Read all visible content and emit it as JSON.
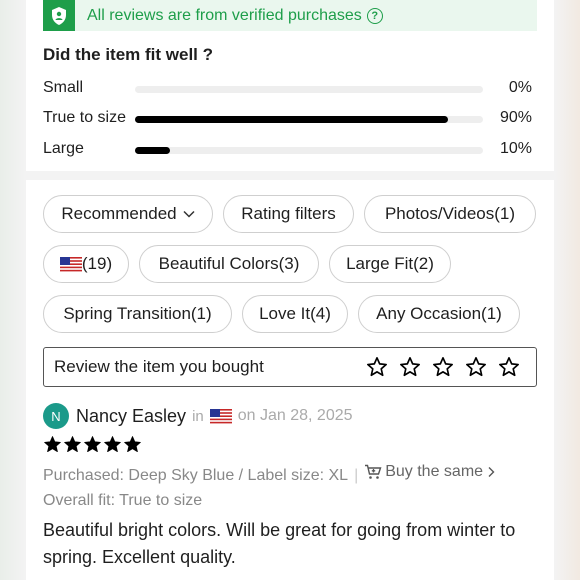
{
  "verified_banner": {
    "text": "All reviews are from verified purchases",
    "help_symbol": "?",
    "icon": "shield-check-icon",
    "color": "#1e9e4a"
  },
  "fit": {
    "title": "Did the item fit well ?",
    "rows": [
      {
        "label": "Small",
        "percent_text": "0%",
        "value": 0
      },
      {
        "label": "True to size",
        "percent_text": "90%",
        "value": 0.9
      },
      {
        "label": "Large",
        "percent_text": "10%",
        "value": 0.1
      }
    ]
  },
  "filters": {
    "recommended": "Recommended",
    "rating_filters": "Rating filters",
    "photos_videos": "Photos/Videos(1)",
    "us_count": "(19)",
    "beautiful_colors": "Beautiful Colors(3)",
    "large_fit": "Large Fit(2)",
    "spring_transition": "Spring Transition(1)",
    "love_it": "Love It(4)",
    "any_occasion": "Any Occasion(1)"
  },
  "review_prompt": {
    "text": "Review the item you bought",
    "star_count": 5
  },
  "review": {
    "avatar_letter": "N",
    "avatar_color": "#1b9a8a",
    "name": "Nancy Easley",
    "in_text": "in",
    "date": "on Jan 28, 2025",
    "rating": 5,
    "purchased": "Purchased: Deep Sky Blue / Label size: XL",
    "separator": "|",
    "buy_same": "Buy the same",
    "overall_fit": "Overall fit: True to size",
    "text": "Beautiful bright colors. Will be great for going from winter to spring. Excellent quality."
  }
}
